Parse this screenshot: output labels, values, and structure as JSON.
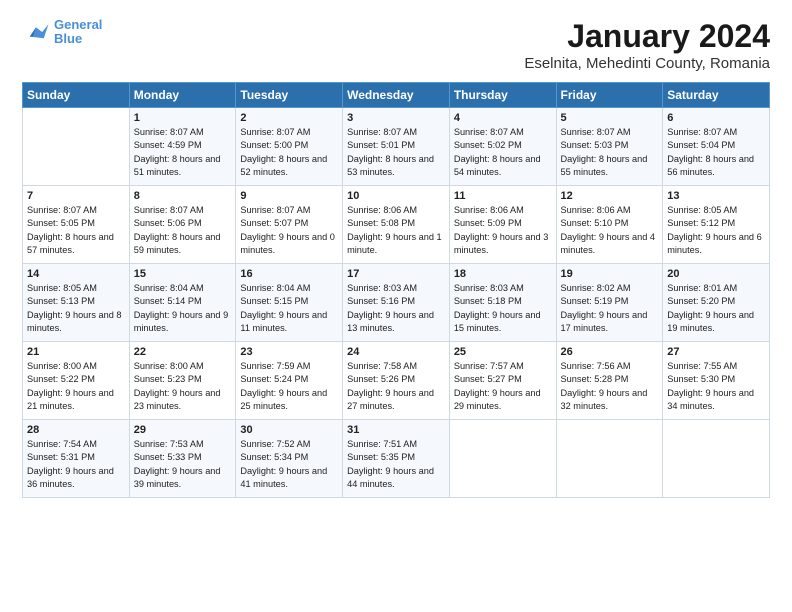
{
  "logo": {
    "line1": "General",
    "line2": "Blue"
  },
  "title": "January 2024",
  "subtitle": "Eselnita, Mehedinti County, Romania",
  "days_header": [
    "Sunday",
    "Monday",
    "Tuesday",
    "Wednesday",
    "Thursday",
    "Friday",
    "Saturday"
  ],
  "weeks": [
    [
      {
        "day": "",
        "sunrise": "",
        "sunset": "",
        "daylight": ""
      },
      {
        "day": "1",
        "sunrise": "Sunrise: 8:07 AM",
        "sunset": "Sunset: 4:59 PM",
        "daylight": "Daylight: 8 hours and 51 minutes."
      },
      {
        "day": "2",
        "sunrise": "Sunrise: 8:07 AM",
        "sunset": "Sunset: 5:00 PM",
        "daylight": "Daylight: 8 hours and 52 minutes."
      },
      {
        "day": "3",
        "sunrise": "Sunrise: 8:07 AM",
        "sunset": "Sunset: 5:01 PM",
        "daylight": "Daylight: 8 hours and 53 minutes."
      },
      {
        "day": "4",
        "sunrise": "Sunrise: 8:07 AM",
        "sunset": "Sunset: 5:02 PM",
        "daylight": "Daylight: 8 hours and 54 minutes."
      },
      {
        "day": "5",
        "sunrise": "Sunrise: 8:07 AM",
        "sunset": "Sunset: 5:03 PM",
        "daylight": "Daylight: 8 hours and 55 minutes."
      },
      {
        "day": "6",
        "sunrise": "Sunrise: 8:07 AM",
        "sunset": "Sunset: 5:04 PM",
        "daylight": "Daylight: 8 hours and 56 minutes."
      }
    ],
    [
      {
        "day": "7",
        "sunrise": "Sunrise: 8:07 AM",
        "sunset": "Sunset: 5:05 PM",
        "daylight": "Daylight: 8 hours and 57 minutes."
      },
      {
        "day": "8",
        "sunrise": "Sunrise: 8:07 AM",
        "sunset": "Sunset: 5:06 PM",
        "daylight": "Daylight: 8 hours and 59 minutes."
      },
      {
        "day": "9",
        "sunrise": "Sunrise: 8:07 AM",
        "sunset": "Sunset: 5:07 PM",
        "daylight": "Daylight: 9 hours and 0 minutes."
      },
      {
        "day": "10",
        "sunrise": "Sunrise: 8:06 AM",
        "sunset": "Sunset: 5:08 PM",
        "daylight": "Daylight: 9 hours and 1 minute."
      },
      {
        "day": "11",
        "sunrise": "Sunrise: 8:06 AM",
        "sunset": "Sunset: 5:09 PM",
        "daylight": "Daylight: 9 hours and 3 minutes."
      },
      {
        "day": "12",
        "sunrise": "Sunrise: 8:06 AM",
        "sunset": "Sunset: 5:10 PM",
        "daylight": "Daylight: 9 hours and 4 minutes."
      },
      {
        "day": "13",
        "sunrise": "Sunrise: 8:05 AM",
        "sunset": "Sunset: 5:12 PM",
        "daylight": "Daylight: 9 hours and 6 minutes."
      }
    ],
    [
      {
        "day": "14",
        "sunrise": "Sunrise: 8:05 AM",
        "sunset": "Sunset: 5:13 PM",
        "daylight": "Daylight: 9 hours and 8 minutes."
      },
      {
        "day": "15",
        "sunrise": "Sunrise: 8:04 AM",
        "sunset": "Sunset: 5:14 PM",
        "daylight": "Daylight: 9 hours and 9 minutes."
      },
      {
        "day": "16",
        "sunrise": "Sunrise: 8:04 AM",
        "sunset": "Sunset: 5:15 PM",
        "daylight": "Daylight: 9 hours and 11 minutes."
      },
      {
        "day": "17",
        "sunrise": "Sunrise: 8:03 AM",
        "sunset": "Sunset: 5:16 PM",
        "daylight": "Daylight: 9 hours and 13 minutes."
      },
      {
        "day": "18",
        "sunrise": "Sunrise: 8:03 AM",
        "sunset": "Sunset: 5:18 PM",
        "daylight": "Daylight: 9 hours and 15 minutes."
      },
      {
        "day": "19",
        "sunrise": "Sunrise: 8:02 AM",
        "sunset": "Sunset: 5:19 PM",
        "daylight": "Daylight: 9 hours and 17 minutes."
      },
      {
        "day": "20",
        "sunrise": "Sunrise: 8:01 AM",
        "sunset": "Sunset: 5:20 PM",
        "daylight": "Daylight: 9 hours and 19 minutes."
      }
    ],
    [
      {
        "day": "21",
        "sunrise": "Sunrise: 8:00 AM",
        "sunset": "Sunset: 5:22 PM",
        "daylight": "Daylight: 9 hours and 21 minutes."
      },
      {
        "day": "22",
        "sunrise": "Sunrise: 8:00 AM",
        "sunset": "Sunset: 5:23 PM",
        "daylight": "Daylight: 9 hours and 23 minutes."
      },
      {
        "day": "23",
        "sunrise": "Sunrise: 7:59 AM",
        "sunset": "Sunset: 5:24 PM",
        "daylight": "Daylight: 9 hours and 25 minutes."
      },
      {
        "day": "24",
        "sunrise": "Sunrise: 7:58 AM",
        "sunset": "Sunset: 5:26 PM",
        "daylight": "Daylight: 9 hours and 27 minutes."
      },
      {
        "day": "25",
        "sunrise": "Sunrise: 7:57 AM",
        "sunset": "Sunset: 5:27 PM",
        "daylight": "Daylight: 9 hours and 29 minutes."
      },
      {
        "day": "26",
        "sunrise": "Sunrise: 7:56 AM",
        "sunset": "Sunset: 5:28 PM",
        "daylight": "Daylight: 9 hours and 32 minutes."
      },
      {
        "day": "27",
        "sunrise": "Sunrise: 7:55 AM",
        "sunset": "Sunset: 5:30 PM",
        "daylight": "Daylight: 9 hours and 34 minutes."
      }
    ],
    [
      {
        "day": "28",
        "sunrise": "Sunrise: 7:54 AM",
        "sunset": "Sunset: 5:31 PM",
        "daylight": "Daylight: 9 hours and 36 minutes."
      },
      {
        "day": "29",
        "sunrise": "Sunrise: 7:53 AM",
        "sunset": "Sunset: 5:33 PM",
        "daylight": "Daylight: 9 hours and 39 minutes."
      },
      {
        "day": "30",
        "sunrise": "Sunrise: 7:52 AM",
        "sunset": "Sunset: 5:34 PM",
        "daylight": "Daylight: 9 hours and 41 minutes."
      },
      {
        "day": "31",
        "sunrise": "Sunrise: 7:51 AM",
        "sunset": "Sunset: 5:35 PM",
        "daylight": "Daylight: 9 hours and 44 minutes."
      },
      {
        "day": "",
        "sunrise": "",
        "sunset": "",
        "daylight": ""
      },
      {
        "day": "",
        "sunrise": "",
        "sunset": "",
        "daylight": ""
      },
      {
        "day": "",
        "sunrise": "",
        "sunset": "",
        "daylight": ""
      }
    ]
  ]
}
